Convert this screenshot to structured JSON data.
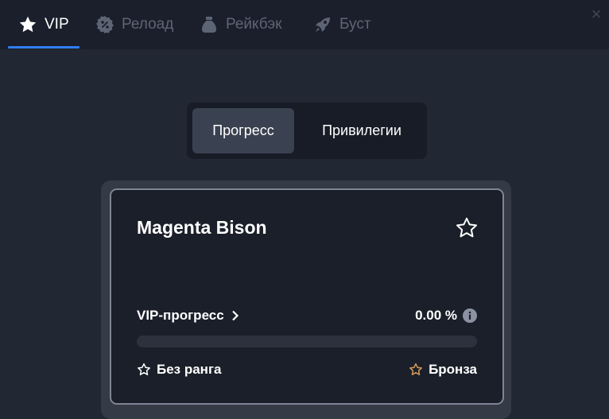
{
  "tabs": [
    {
      "label": "VIP",
      "icon": "star-icon"
    },
    {
      "label": "Релоад",
      "icon": "percent-badge-icon"
    },
    {
      "label": "Рейкбэк",
      "icon": "money-bag-icon"
    },
    {
      "label": "Буст",
      "icon": "rocket-icon"
    }
  ],
  "close_label": "×",
  "segment": {
    "progress": "Прогресс",
    "privileges": "Привилегии"
  },
  "card": {
    "title": "Magenta Bison",
    "vip_progress_label": "VIP-прогресс",
    "progress_value": "0.00 %",
    "progress_fraction": 0,
    "current_rank": "Без ранга",
    "next_rank": "Бронза"
  },
  "colors": {
    "accent": "#2f7ff2",
    "bronze": "#d49a5a",
    "background": "#212733"
  }
}
